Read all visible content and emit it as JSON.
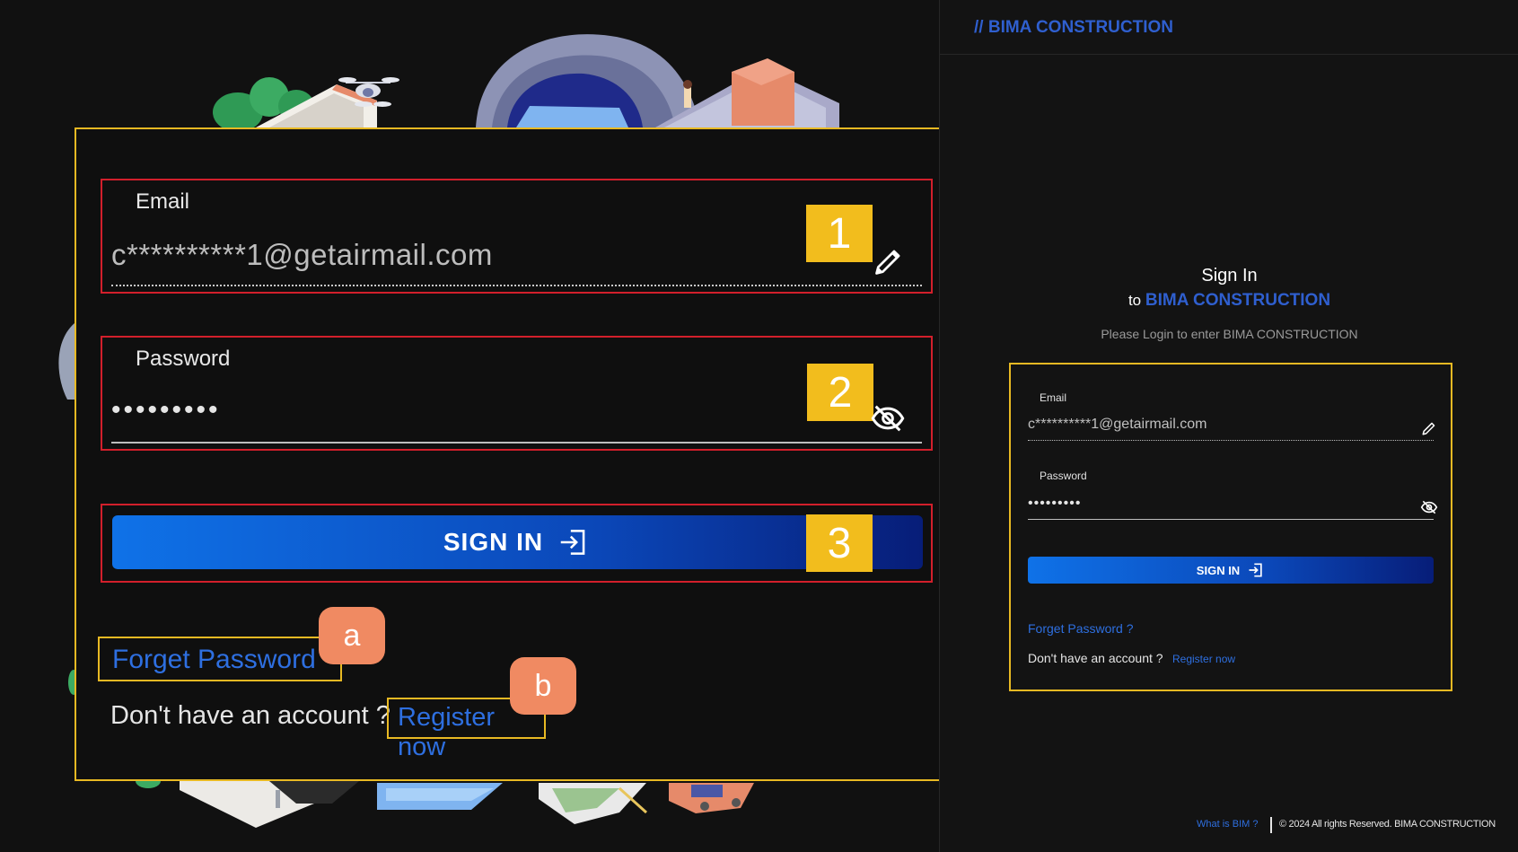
{
  "brand": {
    "slashes": "//",
    "name": "BIMA CONSTRUCTION"
  },
  "login": {
    "title": "Sign In",
    "to_prefix": "to",
    "to_brand": "BIMA CONSTRUCTION",
    "subtitle": "Please Login to enter BIMA CONSTRUCTION",
    "email_label": "Email",
    "email_value": "c**********1@getairmail.com",
    "password_label": "Password",
    "password_value": "•••••••••",
    "sign_in_label": "SIGN IN",
    "forget_password": "Forget Password ?",
    "no_account": "Don't have an account ?",
    "register": "Register now"
  },
  "zoom": {
    "email_label": "Email",
    "email_value": "c**********1@getairmail.com",
    "password_label": "Password",
    "password_value": "•••••••••",
    "sign_in_label": "SIGN IN",
    "forget_password": "Forget Password",
    "no_account": "Don't have an account ?",
    "register": "Register now",
    "badges": [
      "1",
      "2",
      "3"
    ],
    "tags": [
      "a",
      "b"
    ]
  },
  "footer": {
    "what_is_bim": "What is BIM ?",
    "copyright": "© 2024 All rights Reserved. BIMA CONSTRUCTION"
  },
  "colors": {
    "background": "#111111",
    "accent_blue": "#2f5fcf",
    "callout_yellow": "#e8b923",
    "highlight_red": "#d21f2b",
    "badge_yellow": "#f2bd1d",
    "tag_orange": "#f08a62"
  },
  "icons": {
    "edit": "pencil-icon",
    "visibility": "eye-off-icon",
    "signin": "sign-in-arrow-icon"
  }
}
